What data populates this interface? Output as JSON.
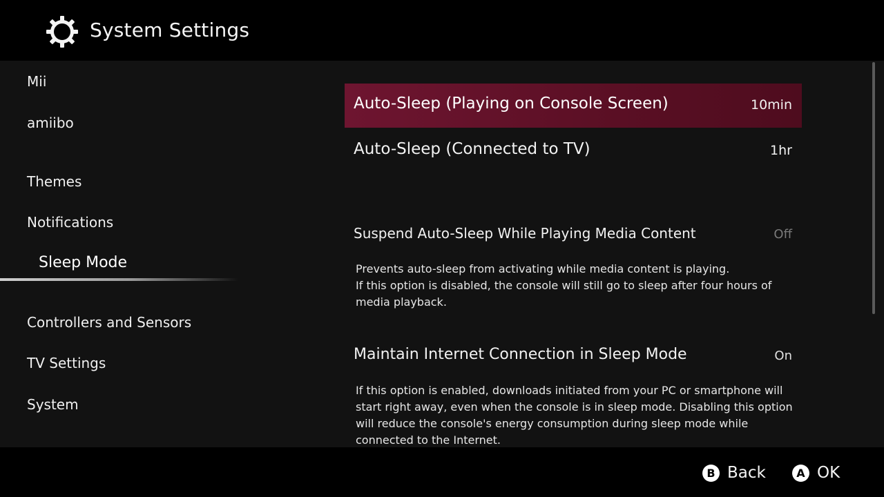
{
  "header": {
    "icon": "gear-icon",
    "title": "System Settings"
  },
  "sidebar": {
    "items": [
      {
        "label": "Mii"
      },
      {
        "label": "amiibo"
      },
      {
        "label": "Themes"
      },
      {
        "label": "Notifications"
      },
      {
        "label": "Sleep Mode",
        "selected": true
      },
      {
        "label": "Controllers and Sensors"
      },
      {
        "label": "TV Settings"
      },
      {
        "label": "System"
      }
    ]
  },
  "settings": [
    {
      "label": "Auto-Sleep (Playing on Console Screen)",
      "value": "10min",
      "highlighted": true
    },
    {
      "label": "Auto-Sleep (Connected to TV)",
      "value": "1hr"
    },
    {
      "label": "Suspend Auto-Sleep While Playing Media Content",
      "value": "Off",
      "description": [
        "Prevents auto-sleep from activating while media content is playing.",
        "If this option is disabled, the console will still go to sleep after four hours of",
        "media playback."
      ]
    },
    {
      "label": "Maintain Internet Connection in Sleep Mode",
      "value": "On",
      "description": [
        "If this option is enabled, downloads initiated from your PC or smartphone will",
        "start right away, even when the console is in sleep mode. Disabling this option",
        "will reduce the console's energy consumption during sleep mode while",
        "connected to the Internet."
      ]
    }
  ],
  "footer": {
    "back": {
      "button": "B",
      "label": "Back"
    },
    "ok": {
      "button": "A",
      "label": "OK"
    }
  },
  "colors": {
    "highlight": "#6e1530",
    "background": "#121212",
    "bars": "#000000"
  }
}
